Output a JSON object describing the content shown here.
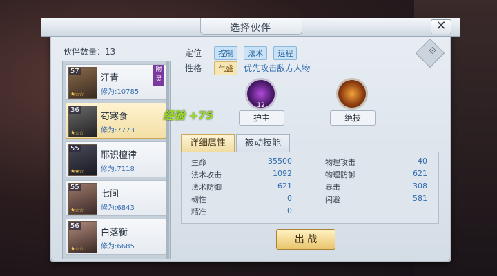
{
  "window": {
    "title": "选择伙伴",
    "close_label": "✕"
  },
  "list": {
    "count_label": "伙伴数量：13",
    "partners": [
      {
        "level": "57",
        "name": "汗青",
        "power": "修为:10785",
        "stars": "★☆☆",
        "badge": "附灵",
        "selected": false
      },
      {
        "level": "36",
        "name": "苟寒食",
        "power": "修为:7773",
        "stars": "★☆☆",
        "badge": "",
        "selected": true
      },
      {
        "level": "55",
        "name": "耶识檀律",
        "power": "修为:7118",
        "stars": "★★☆",
        "badge": "",
        "selected": false
      },
      {
        "level": "55",
        "name": "七间",
        "power": "修为:6843",
        "stars": "★☆☆",
        "badge": "",
        "selected": false
      },
      {
        "level": "56",
        "name": "白落衡",
        "power": "修为:6685",
        "stars": "★☆☆",
        "badge": "",
        "selected": false
      }
    ]
  },
  "detail": {
    "position_label": "定位",
    "position_tags": [
      "控制",
      "法术",
      "远程"
    ],
    "trait_label": "性格",
    "trait_tag": "气盛",
    "trait_desc": "优先攻击敌方人物",
    "exp_gain": "经验 +75",
    "skills": [
      {
        "name": "护主",
        "badge": "12",
        "color": "#6a2a8a"
      },
      {
        "name": "绝技",
        "badge": "",
        "color": "#c06a1a"
      }
    ],
    "tabs": [
      "详细属性",
      "被动技能"
    ],
    "stats_left": [
      {
        "label": "生命",
        "value": "35500"
      },
      {
        "label": "法术攻击",
        "value": "1092"
      },
      {
        "label": "法术防御",
        "value": "621"
      },
      {
        "label": "韧性",
        "value": "0"
      },
      {
        "label": "精准",
        "value": "0"
      }
    ],
    "stats_right": [
      {
        "label": "物理攻击",
        "value": "40"
      },
      {
        "label": "物理防御",
        "value": "621"
      },
      {
        "label": "暴击",
        "value": "308"
      },
      {
        "label": "闪避",
        "value": "581"
      }
    ],
    "deploy_label": "出 战"
  }
}
